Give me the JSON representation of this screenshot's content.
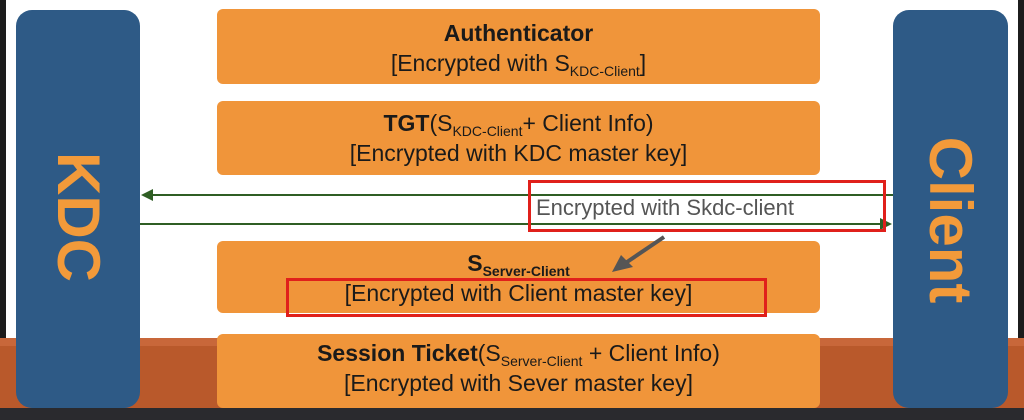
{
  "nodes": {
    "kdc": {
      "label": "KDC",
      "fill": "#2e5a86",
      "text_color": "#f29a3a"
    },
    "client": {
      "label": "Client",
      "fill": "#2e5a86",
      "text_color": "#f29a3a"
    }
  },
  "boxes": [
    {
      "title": "Authenticator",
      "line2_pre": "[Encrypted with S",
      "line2_sub": "KDC-Client",
      "line2_post": "]"
    },
    {
      "title": "TGT",
      "title_rest_pre": "(S",
      "title_sub": "KDC-Client",
      "title_rest_post": "+ Client Info)",
      "line2": "[Encrypted with KDC master key]"
    },
    {
      "title": "S",
      "title_sub": "Server-Client",
      "line2": "[Encrypted with Client master key]"
    },
    {
      "title": "Session Ticket",
      "title_rest_pre": "(S",
      "title_sub": "Server-Client",
      "title_rest_post": " + Client Info)",
      "line2": "[Encrypted with Sever master key]"
    }
  ],
  "exchange": {
    "label": "Encrypted with Skdc-client",
    "arrow_color": "#2f5e24"
  },
  "colors": {
    "box_fill": "#f0953a",
    "highlight": "#e0201b",
    "floor": "#b9592b",
    "pointer_arrow": "#555555"
  }
}
